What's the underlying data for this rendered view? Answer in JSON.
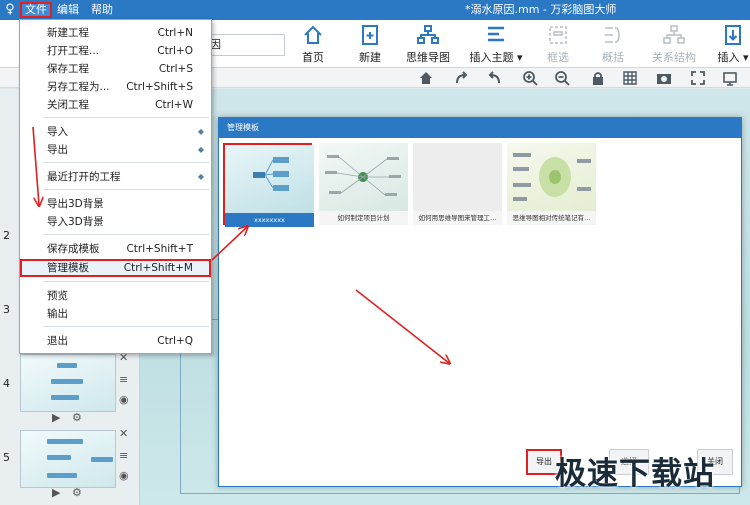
{
  "window": {
    "app_icon": "mindmap-app-icon",
    "title": "*溺水原因.mm - 万彩脑图大师",
    "menus": [
      "文件",
      "编辑",
      "帮助"
    ]
  },
  "ribbon": {
    "title_field_value": "因",
    "buttons": [
      {
        "label": "首页",
        "icon": "home-icon"
      },
      {
        "label": "新建",
        "icon": "new-file-icon"
      },
      {
        "label": "思维导图",
        "icon": "mindmap-icon"
      },
      {
        "label": "插入主题",
        "icon": "insert-topic-icon",
        "dropdown": "▾"
      },
      {
        "label": "框选",
        "icon": "box-select-icon"
      },
      {
        "label": "概括",
        "icon": "summary-icon"
      },
      {
        "label": "关系结构",
        "icon": "relation-icon"
      },
      {
        "label": "插入",
        "icon": "insert-icon",
        "dropdown": "▾"
      }
    ]
  },
  "file_menu": {
    "items": [
      {
        "label": "新建工程",
        "shortcut": "Ctrl+N"
      },
      {
        "label": "打开工程...",
        "shortcut": "Ctrl+O"
      },
      {
        "label": "保存工程",
        "shortcut": "Ctrl+S"
      },
      {
        "label": "另存工程为...",
        "shortcut": "Ctrl+Shift+S"
      },
      {
        "label": "关闭工程",
        "shortcut": "Ctrl+W"
      },
      {
        "label": "导入",
        "shortcut": ""
      },
      {
        "label": "导出",
        "shortcut": ""
      },
      {
        "label": "最近打开的工程",
        "shortcut": ""
      },
      {
        "label": "导出3D背景",
        "shortcut": ""
      },
      {
        "label": "导入3D背景",
        "shortcut": ""
      },
      {
        "label": "保存成模板",
        "shortcut": "Ctrl+Shift+T"
      },
      {
        "label": "管理模板",
        "shortcut": "Ctrl+Shift+M"
      },
      {
        "label": "预览",
        "shortcut": ""
      },
      {
        "label": "输出",
        "shortcut": ""
      },
      {
        "label": "退出",
        "shortcut": "Ctrl+Q"
      }
    ],
    "submenu_arrow": "◆"
  },
  "slides": [
    {
      "number": "2"
    },
    {
      "number": "3"
    },
    {
      "number": "4"
    },
    {
      "number": "5"
    }
  ],
  "dialog": {
    "title": "管理模板",
    "templates": [
      {
        "caption": "xxxxxxxx"
      },
      {
        "caption": "如何制定项目计划"
      },
      {
        "caption": "如何用思维导图来管理工..."
      },
      {
        "caption": "思维导图相对传统笔记有..."
      }
    ],
    "export_button": "导出",
    "select_button": "选择",
    "close_button": "关闭"
  },
  "watermark": "极速下载站",
  "colors": {
    "accent": "#2b78c5",
    "highlight": "#e02020"
  }
}
